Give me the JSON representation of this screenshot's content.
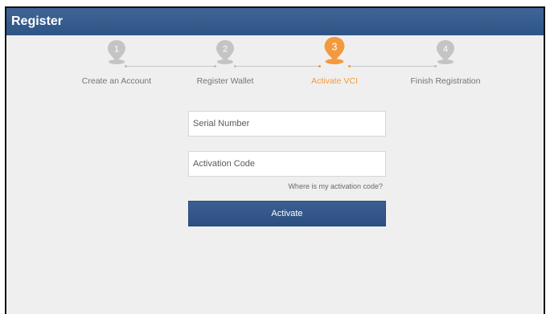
{
  "header": {
    "title": "Register"
  },
  "steps": [
    {
      "number": "1",
      "label": "Create an Account",
      "state": "inactive"
    },
    {
      "number": "2",
      "label": "Register Wallet",
      "state": "inactive"
    },
    {
      "number": "3",
      "label": "Activate VCI",
      "state": "active"
    },
    {
      "number": "4",
      "label": "Finish Registration",
      "state": "inactive"
    }
  ],
  "form": {
    "serial_placeholder": "Serial Number",
    "activation_placeholder": "Activation Code",
    "help_link": "Where is my activation code?",
    "activate_label": "Activate"
  },
  "colors": {
    "header": "#2f5586",
    "active_step": "#f39a3e",
    "inactive_step": "#c4c4c4",
    "background": "#efefef",
    "button": "#2c4f80"
  }
}
